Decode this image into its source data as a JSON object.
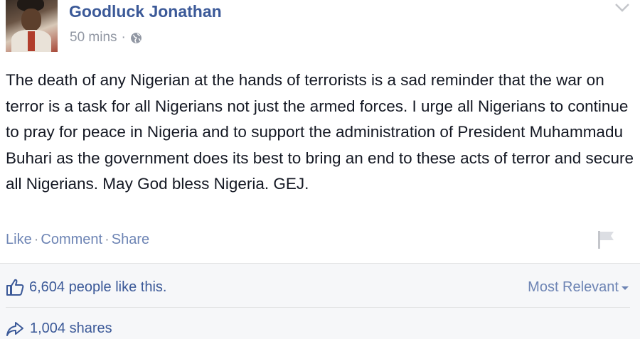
{
  "post": {
    "author": "Goodluck Jonathan",
    "timestamp": "50 mins",
    "separator": "·",
    "privacy_icon": "globe-icon",
    "body": "The death of any Nigerian at the hands of terrorists is a sad reminder that the war on terror is a task for all Nigerians not just the armed forces. I urge all Nigerians to continue to pray for peace in Nigeria and to support the administration of President Muhammadu Buhari as the government does its best to bring an end to these acts of terror and secure all Nigerians. May God bless Nigeria. GEJ.",
    "menu_icon": "chevron-down-icon"
  },
  "actions": {
    "like": "Like",
    "comment": "Comment",
    "share": "Share",
    "separator": "·",
    "report_icon": "flag-icon"
  },
  "feedback": {
    "likes_text": "6,604 people like this.",
    "sort_label": "Most Relevant",
    "shares_text": "1,004 shares"
  },
  "colors": {
    "name": "#3b5998",
    "meta": "#9197a3",
    "link": "#6d84b4",
    "body_text": "#141823",
    "feedback_bg": "#f6f7f9",
    "divider": "#e1e2e3"
  }
}
